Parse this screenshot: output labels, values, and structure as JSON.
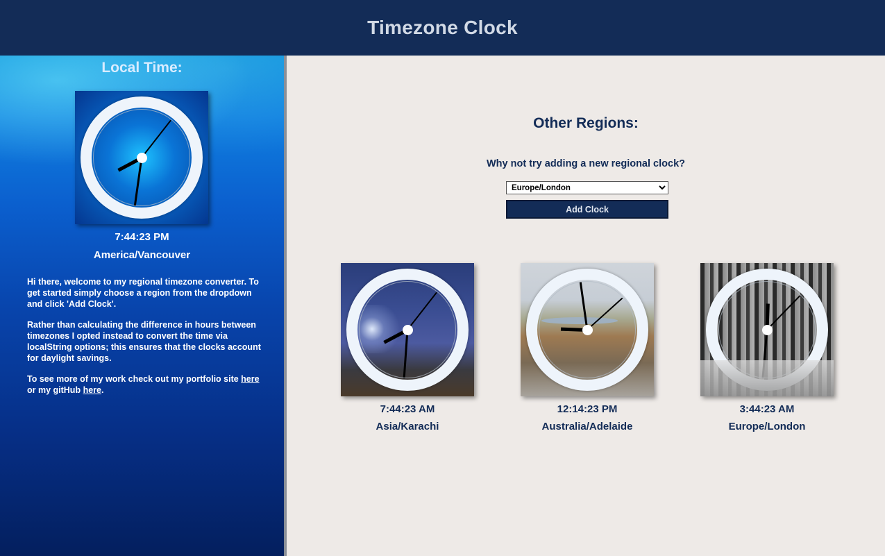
{
  "header": {
    "title": "Timezone Clock"
  },
  "local": {
    "title": "Local Time:",
    "time": "7:44:23 PM",
    "zone": "America/Vancouver",
    "hands": {
      "hour_deg": 242,
      "min_deg": 188,
      "sec_deg": 38
    }
  },
  "intro": {
    "p1": "Hi there, welcome to my regional timezone converter. To get started simply choose a region from the dropdown and click 'Add Clock'.",
    "p2": "Rather than calculating the difference in hours between timezones I opted instead to convert the time via localString options; this ensures that the clocks account for daylight savings.",
    "p3_before": "To see more of my work check out my portfolio site ",
    "link1": "here",
    "p3_middle": " or my gitHub ",
    "link2": "here",
    "p3_after": "."
  },
  "other": {
    "title": "Other Regions:",
    "prompt": "Why not try adding a new regional clock?",
    "select_value": "Europe/London",
    "add_label": "Add Clock"
  },
  "clocks": [
    {
      "time": "7:44:23 AM",
      "zone": "Asia/Karachi",
      "hands": {
        "hour_deg": 242,
        "min_deg": 184,
        "sec_deg": 38
      }
    },
    {
      "time": "12:14:23 PM",
      "zone": "Australia/Adelaide",
      "hands": {
        "hour_deg": 272,
        "min_deg": 352,
        "sec_deg": 48
      }
    },
    {
      "time": "3:44:23 AM",
      "zone": "Europe/London",
      "hands": {
        "hour_deg": 2,
        "min_deg": 185,
        "sec_deg": 44
      }
    }
  ],
  "colors": {
    "navy": "#132c57",
    "panel_bg": "#eeeae7",
    "white": "#ffffff"
  }
}
